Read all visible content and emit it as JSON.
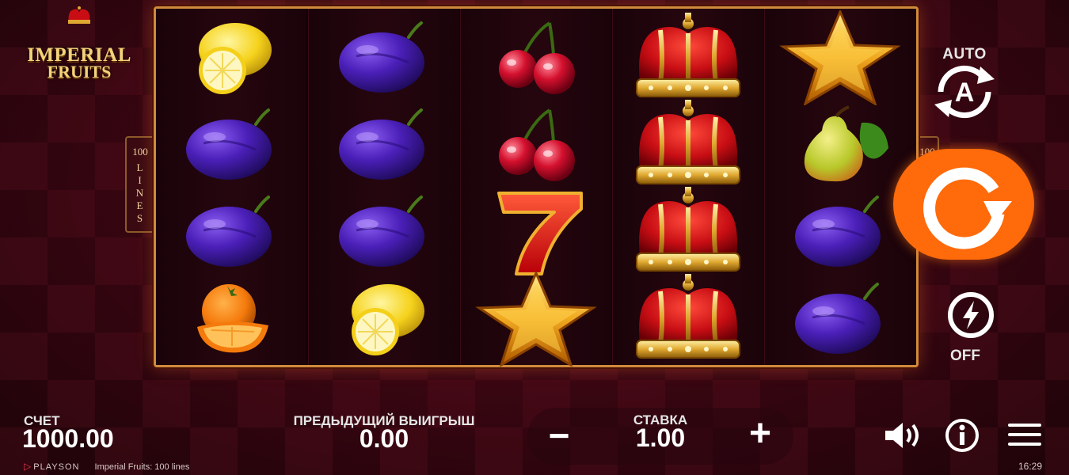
{
  "game": {
    "logo_line1": "IMPERIAL",
    "logo_line2": "FRUITS",
    "lines_number": "100",
    "lines_word": "LINES"
  },
  "reels": [
    [
      "lemon",
      "plum",
      "plum",
      "orange"
    ],
    [
      "plum",
      "plum",
      "plum",
      "lemon"
    ],
    [
      "cherry",
      "cherry",
      "seven",
      "star"
    ],
    [
      "crown",
      "crown",
      "crown",
      "crown"
    ],
    [
      "star",
      "pear",
      "plum",
      "plum"
    ]
  ],
  "controls": {
    "auto_label": "AUTO",
    "auto_icon": "autoplay-icon",
    "spin_icon": "spin-icon",
    "turbo_label": "OFF",
    "turbo_icon": "lightning-icon"
  },
  "stats": {
    "balance_label": "СЧЕТ",
    "balance_value": "1000.00",
    "last_win_label": "ПРЕДЫДУЩИЙ ВЫИГРЫШ",
    "last_win_value": "0.00",
    "bet_label": "СТАВКА",
    "bet_value": "1.00",
    "minus_label": "−",
    "plus_label": "+"
  },
  "icons": {
    "sound": "speaker-icon",
    "info": "info-icon",
    "menu": "hamburger-menu-icon"
  },
  "footer": {
    "provider": "PLAYSON",
    "game_title": "Imperial Fruits: 100 lines",
    "clock": "16:29"
  },
  "colors": {
    "spin_button": "#ff6a0a",
    "frame_gold": "#d08a3c",
    "background": "#3a0612"
  }
}
